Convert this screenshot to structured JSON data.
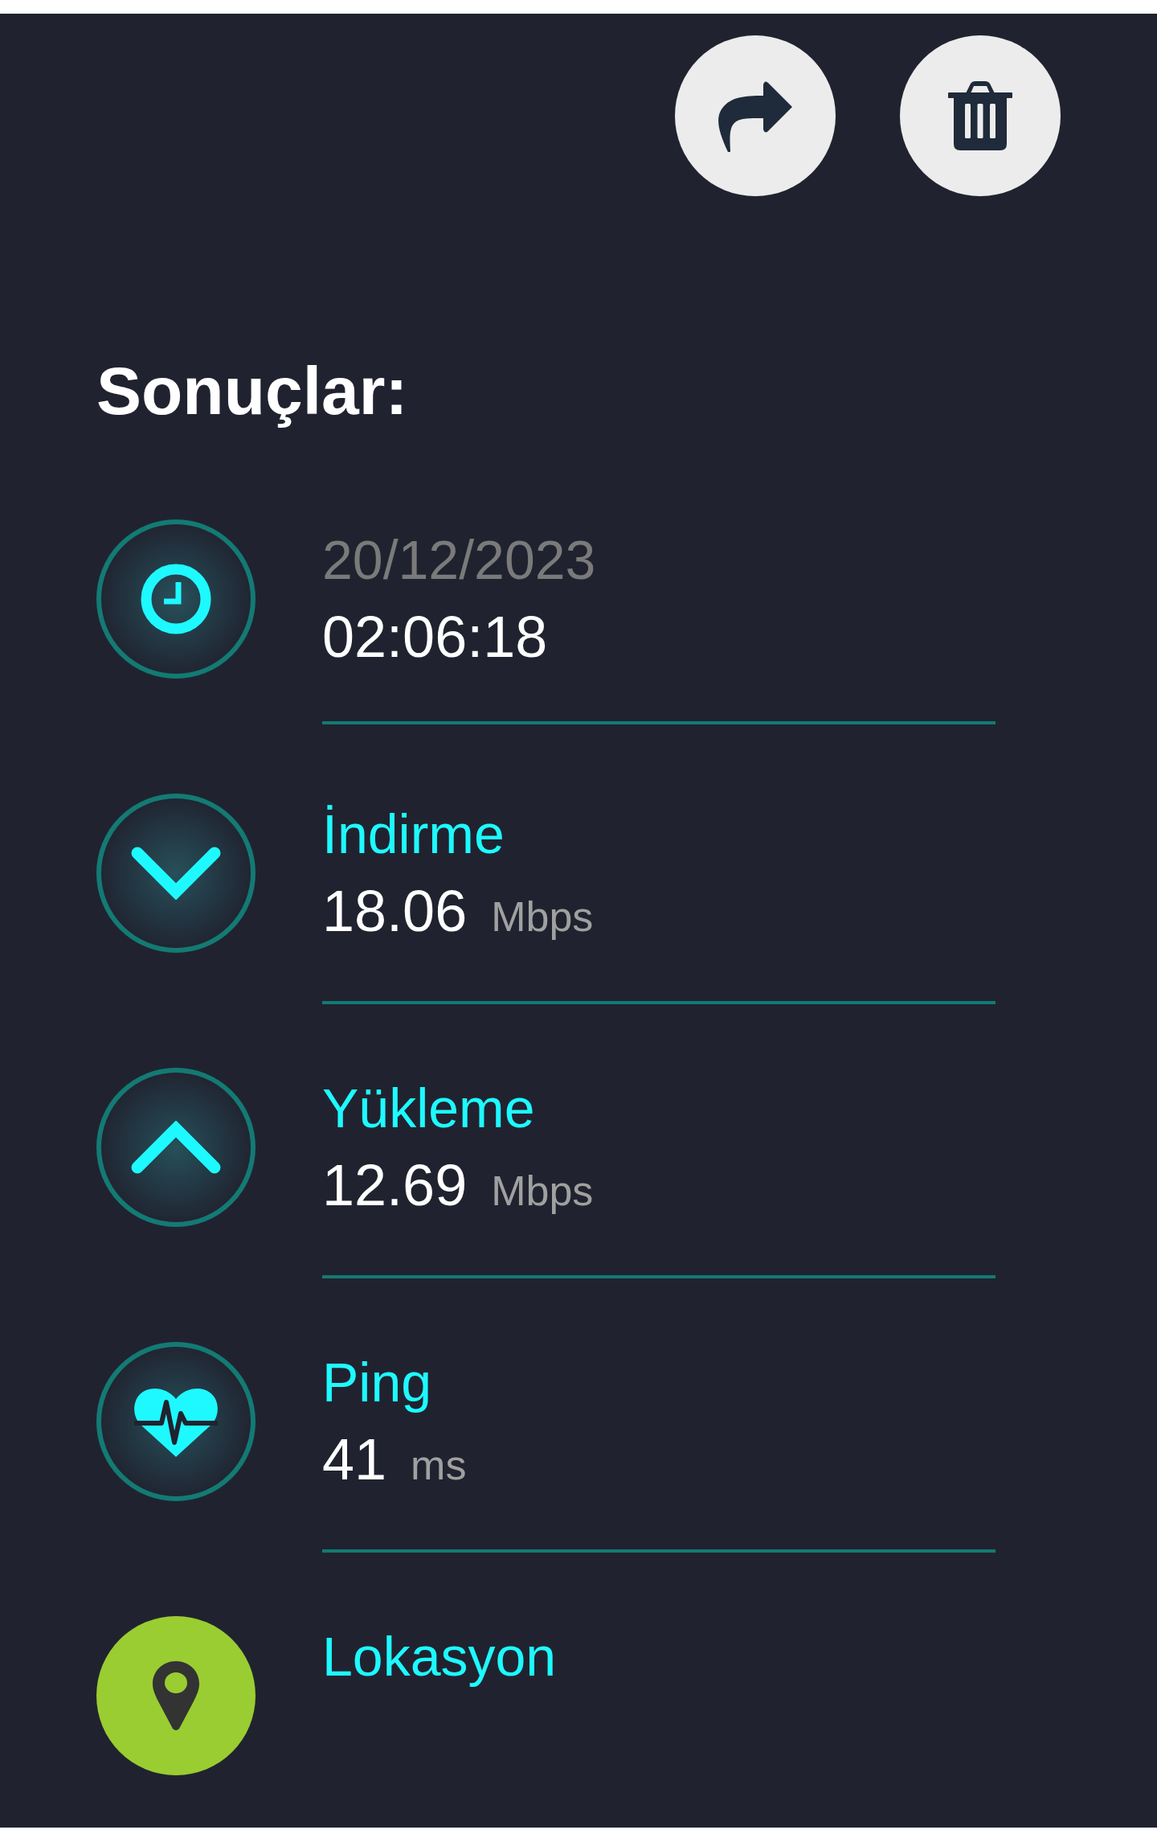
{
  "actions": [
    {
      "kind": "share"
    },
    {
      "kind": "delete"
    }
  ],
  "title": "Sonuçlar:",
  "results": [
    {
      "kind": "time",
      "label": "20/12/2023",
      "value": "02:06:18"
    },
    {
      "kind": "download",
      "label": "İndirme",
      "value": "18.06",
      "unit": "Mbps"
    },
    {
      "kind": "upload",
      "label": "Yükleme",
      "value": "12.69",
      "unit": "Mbps"
    },
    {
      "kind": "ping",
      "label": "Ping",
      "value": "41",
      "unit": "ms"
    },
    {
      "kind": "location",
      "label": "Lokasyon"
    }
  ]
}
